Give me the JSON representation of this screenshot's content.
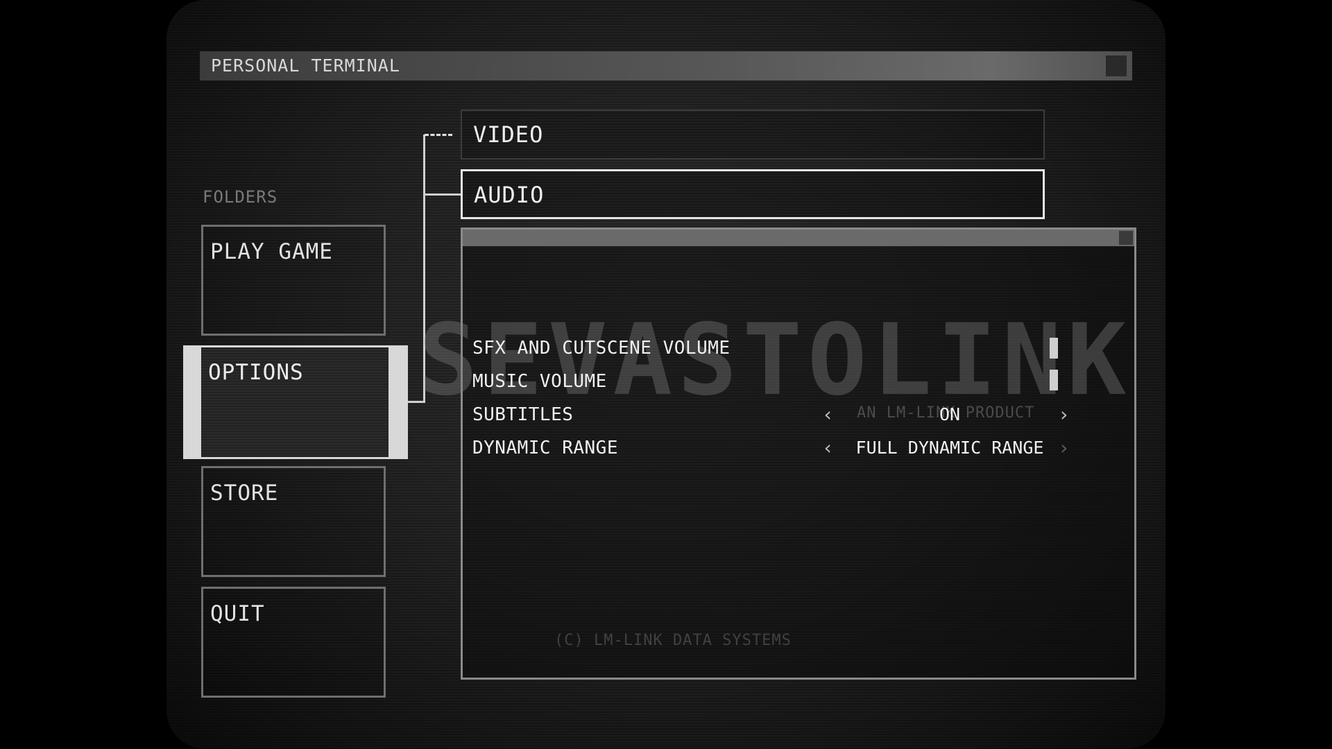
{
  "window": {
    "title": "PERSONAL TERMINAL"
  },
  "sidebar": {
    "heading": "FOLDERS",
    "items": [
      {
        "label": "PLAY GAME"
      },
      {
        "label": "OPTIONS"
      },
      {
        "label": "STORE"
      },
      {
        "label": "QUIT"
      }
    ],
    "selected": "OPTIONS"
  },
  "tabs": [
    {
      "label": "VIDEO"
    },
    {
      "label": "AUDIO"
    }
  ],
  "active_tab": "AUDIO",
  "panel": {
    "watermark": "SEVASTOLINK",
    "watermark_sub": "AN LM-LINK PRODUCT",
    "copyright": "(C) LM-LINK DATA SYSTEMS",
    "settings": [
      {
        "label": "SFX AND CUTSCENE VOLUME",
        "type": "slider",
        "level": 1.0
      },
      {
        "label": "MUSIC VOLUME",
        "type": "slider",
        "level": 1.0
      },
      {
        "label": "SUBTITLES",
        "type": "choice",
        "value": "ON"
      },
      {
        "label": "DYNAMIC RANGE",
        "type": "choice",
        "value": "FULL DYNAMIC RANGE"
      }
    ]
  },
  "icons": {
    "prev": "chevron-left-icon",
    "next": "chevron-right-icon"
  },
  "colors": {
    "text": "#f0f0f0",
    "selection": "#d8d8d8",
    "panel_border": "#8a8a8a"
  }
}
